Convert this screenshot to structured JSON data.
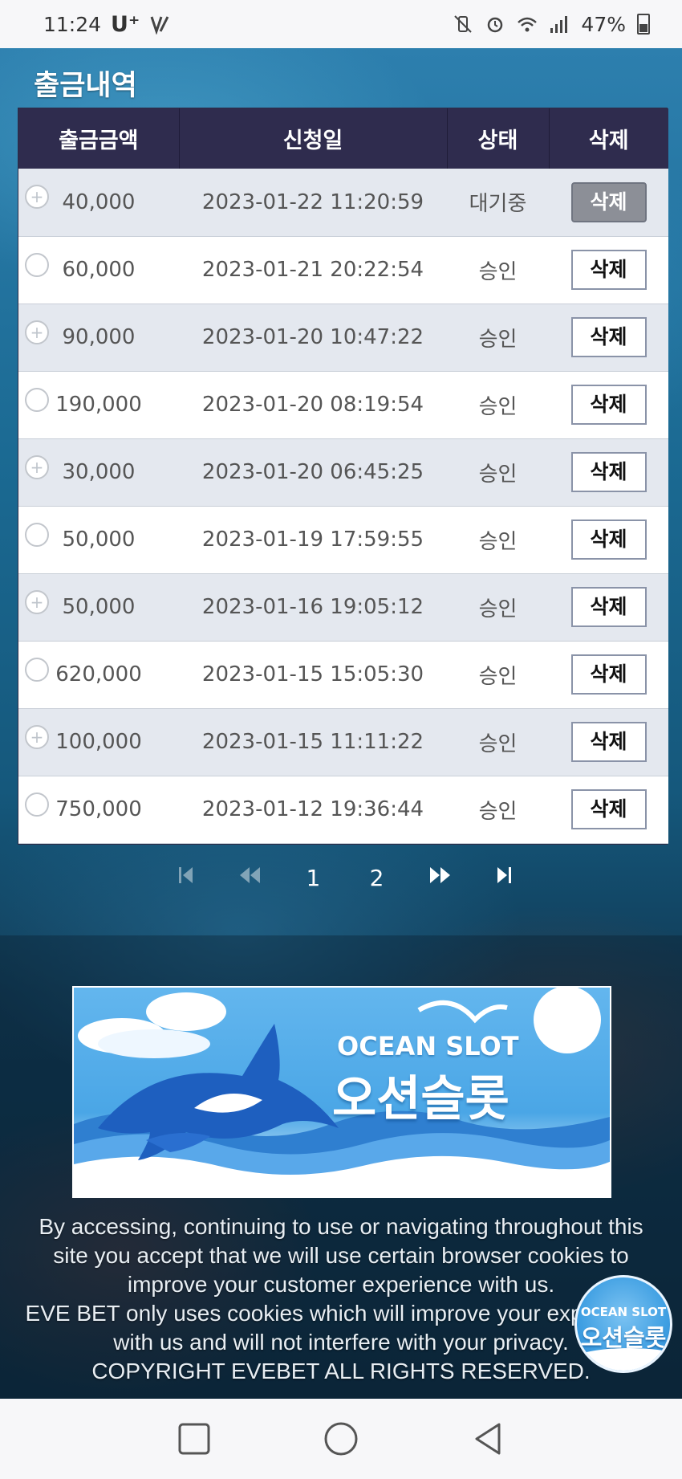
{
  "status_bar": {
    "time": "11:24",
    "carrier": "U⁺",
    "battery": "47%"
  },
  "page": {
    "title": "출금내역"
  },
  "table": {
    "headers": [
      "출금금액",
      "신청일",
      "상태",
      "삭제"
    ],
    "rows": [
      {
        "amount": "40,000",
        "date": "2023-01-22 11:20:59",
        "status": "대기중",
        "action": "삭제",
        "pending": true
      },
      {
        "amount": "60,000",
        "date": "2023-01-21 20:22:54",
        "status": "승인",
        "action": "삭제",
        "pending": false
      },
      {
        "amount": "90,000",
        "date": "2023-01-20 10:47:22",
        "status": "승인",
        "action": "삭제",
        "pending": false
      },
      {
        "amount": "190,000",
        "date": "2023-01-20 08:19:54",
        "status": "승인",
        "action": "삭제",
        "pending": false
      },
      {
        "amount": "30,000",
        "date": "2023-01-20 06:45:25",
        "status": "승인",
        "action": "삭제",
        "pending": false
      },
      {
        "amount": "50,000",
        "date": "2023-01-19 17:59:55",
        "status": "승인",
        "action": "삭제",
        "pending": false
      },
      {
        "amount": "50,000",
        "date": "2023-01-16 19:05:12",
        "status": "승인",
        "action": "삭제",
        "pending": false
      },
      {
        "amount": "620,000",
        "date": "2023-01-15 15:05:30",
        "status": "승인",
        "action": "삭제",
        "pending": false
      },
      {
        "amount": "100,000",
        "date": "2023-01-15 11:11:22",
        "status": "승인",
        "action": "삭제",
        "pending": false
      },
      {
        "amount": "750,000",
        "date": "2023-01-12 19:36:44",
        "status": "승인",
        "action": "삭제",
        "pending": false
      }
    ]
  },
  "pagination": {
    "pages": [
      "1",
      "2"
    ],
    "icons": [
      "first-page-icon",
      "prev-page-icon",
      "next-page-icon",
      "last-page-icon"
    ]
  },
  "banner": {
    "title_en": "OCEAN SLOT",
    "title_ko": "오션슬롯"
  },
  "footer": {
    "lines": [
      "By accessing, continuing to use or navigating throughout this",
      "site you accept that we will use certain browser cookies to",
      "improve your customer experience with us.",
      "EVE BET only uses cookies which will improve your experience",
      "with us and will not interfere with your privacy.",
      "COPYRIGHT EVEBET ALL RIGHTS RESERVED."
    ]
  },
  "floating_badge": {
    "title_en": "OCEAN SLOT",
    "title_ko": "오션슬롯"
  },
  "colors": {
    "header_bg": "#2f2c4e",
    "pending_button": "#8c8f97",
    "row_alt": "#e4e8ef"
  }
}
